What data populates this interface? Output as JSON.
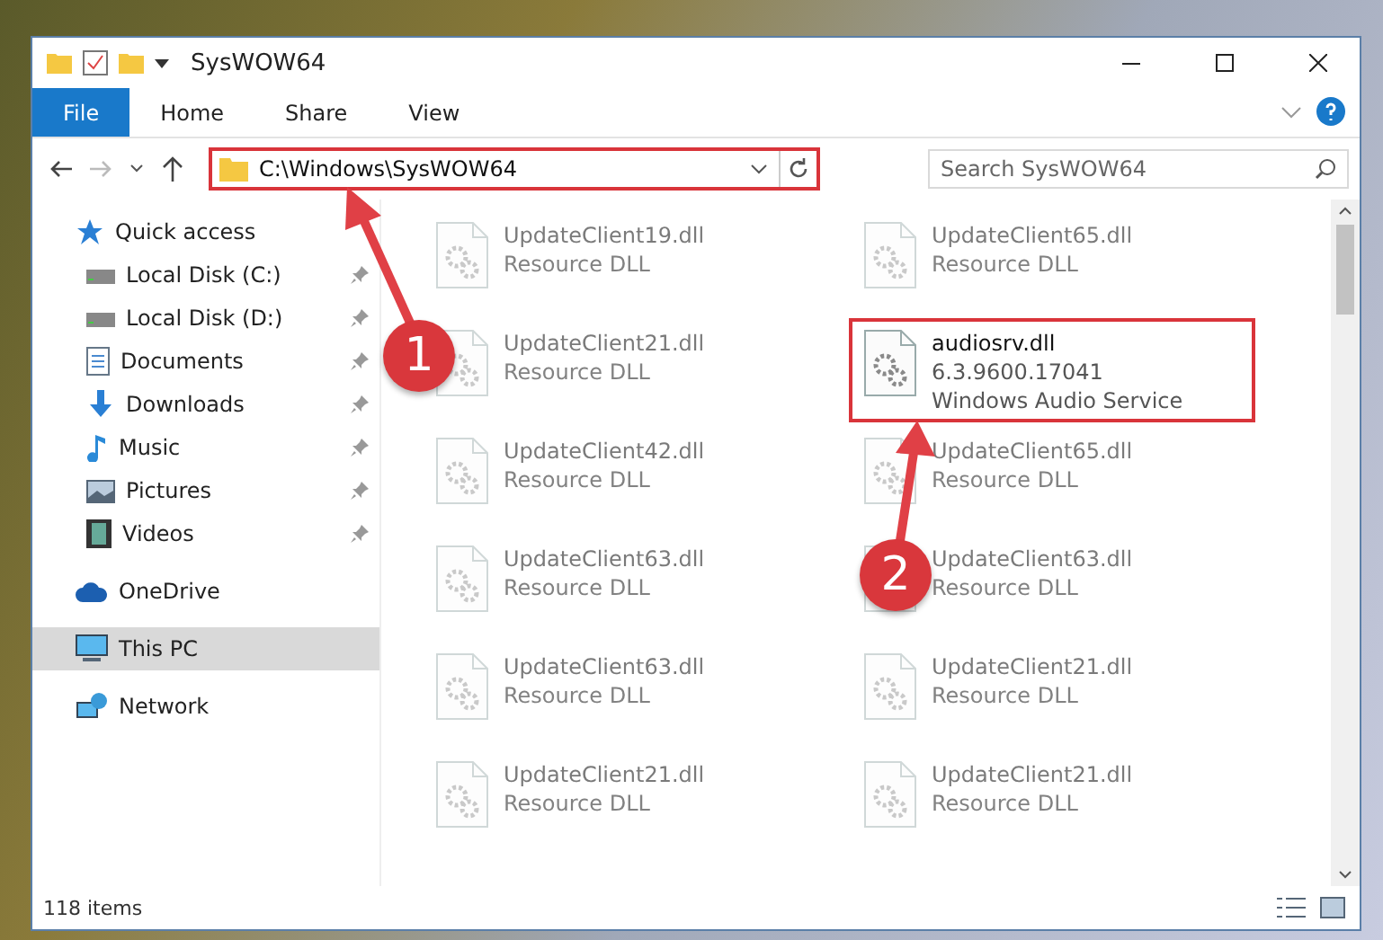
{
  "window": {
    "title": "SysWOW64"
  },
  "ribbon": {
    "tabs": [
      {
        "label": "File",
        "selected": true
      },
      {
        "label": "Home",
        "selected": false
      },
      {
        "label": "Share",
        "selected": false
      },
      {
        "label": "View",
        "selected": false
      }
    ]
  },
  "address_bar": {
    "path": "C:\\Windows\\SysWOW64",
    "annotated": true
  },
  "search": {
    "placeholder": "Search SysWOW64"
  },
  "sidebar": {
    "items": [
      {
        "label": "Quick access",
        "kind": "star",
        "selected": false,
        "children": [
          {
            "label": "Local Disk (C:)",
            "kind": "disk",
            "pinned": true,
            "selected": false
          },
          {
            "label": "Local Disk (D:)",
            "kind": "disk",
            "pinned": true,
            "selected": false
          },
          {
            "label": "Documents",
            "kind": "document",
            "pinned": true,
            "selected": false
          },
          {
            "label": "Downloads",
            "kind": "download",
            "pinned": true,
            "selected": false
          },
          {
            "label": "Music",
            "kind": "music",
            "pinned": true,
            "selected": false
          },
          {
            "label": "Pictures",
            "kind": "picture",
            "pinned": true,
            "selected": false
          },
          {
            "label": "Videos",
            "kind": "video",
            "pinned": true,
            "selected": false
          }
        ]
      },
      {
        "label": "OneDrive",
        "kind": "cloud",
        "selected": false
      },
      {
        "label": "This PC",
        "kind": "pc",
        "selected": true
      },
      {
        "label": "Network",
        "kind": "network",
        "selected": false
      }
    ]
  },
  "files": [
    {
      "name": "UpdateClient19.dll",
      "details": [
        "Resource DLL"
      ],
      "faded": true,
      "annotated": false
    },
    {
      "name": "UpdateClient65.dll",
      "details": [
        "Resource DLL"
      ],
      "faded": true,
      "annotated": false
    },
    {
      "name": "UpdateClient21.dll",
      "details": [
        "Resource DLL"
      ],
      "faded": true,
      "annotated": false
    },
    {
      "name": "audiosrv.dll",
      "details": [
        "6.3.9600.17041",
        "Windows Audio Service"
      ],
      "faded": false,
      "annotated": true
    },
    {
      "name": "UpdateClient42.dll",
      "details": [
        "Resource DLL"
      ],
      "faded": true,
      "annotated": false
    },
    {
      "name": "UpdateClient65.dll",
      "details": [
        "Resource DLL"
      ],
      "faded": true,
      "annotated": false
    },
    {
      "name": "UpdateClient63.dll",
      "details": [
        "Resource DLL"
      ],
      "faded": true,
      "annotated": false
    },
    {
      "name": "UpdateClient63.dll",
      "details": [
        "Resource DLL"
      ],
      "faded": true,
      "annotated": false
    },
    {
      "name": "UpdateClient63.dll",
      "details": [
        "Resource DLL"
      ],
      "faded": true,
      "annotated": false
    },
    {
      "name": "UpdateClient21.dll",
      "details": [
        "Resource DLL"
      ],
      "faded": true,
      "annotated": false
    },
    {
      "name": "UpdateClient21.dll",
      "details": [
        "Resource DLL"
      ],
      "faded": true,
      "annotated": false
    },
    {
      "name": "UpdateClient21.dll",
      "details": [
        "Resource DLL"
      ],
      "faded": true,
      "annotated": false
    }
  ],
  "status_bar": {
    "item_count": "118 items"
  },
  "annotations": [
    {
      "label": "1"
    },
    {
      "label": "2"
    }
  ]
}
